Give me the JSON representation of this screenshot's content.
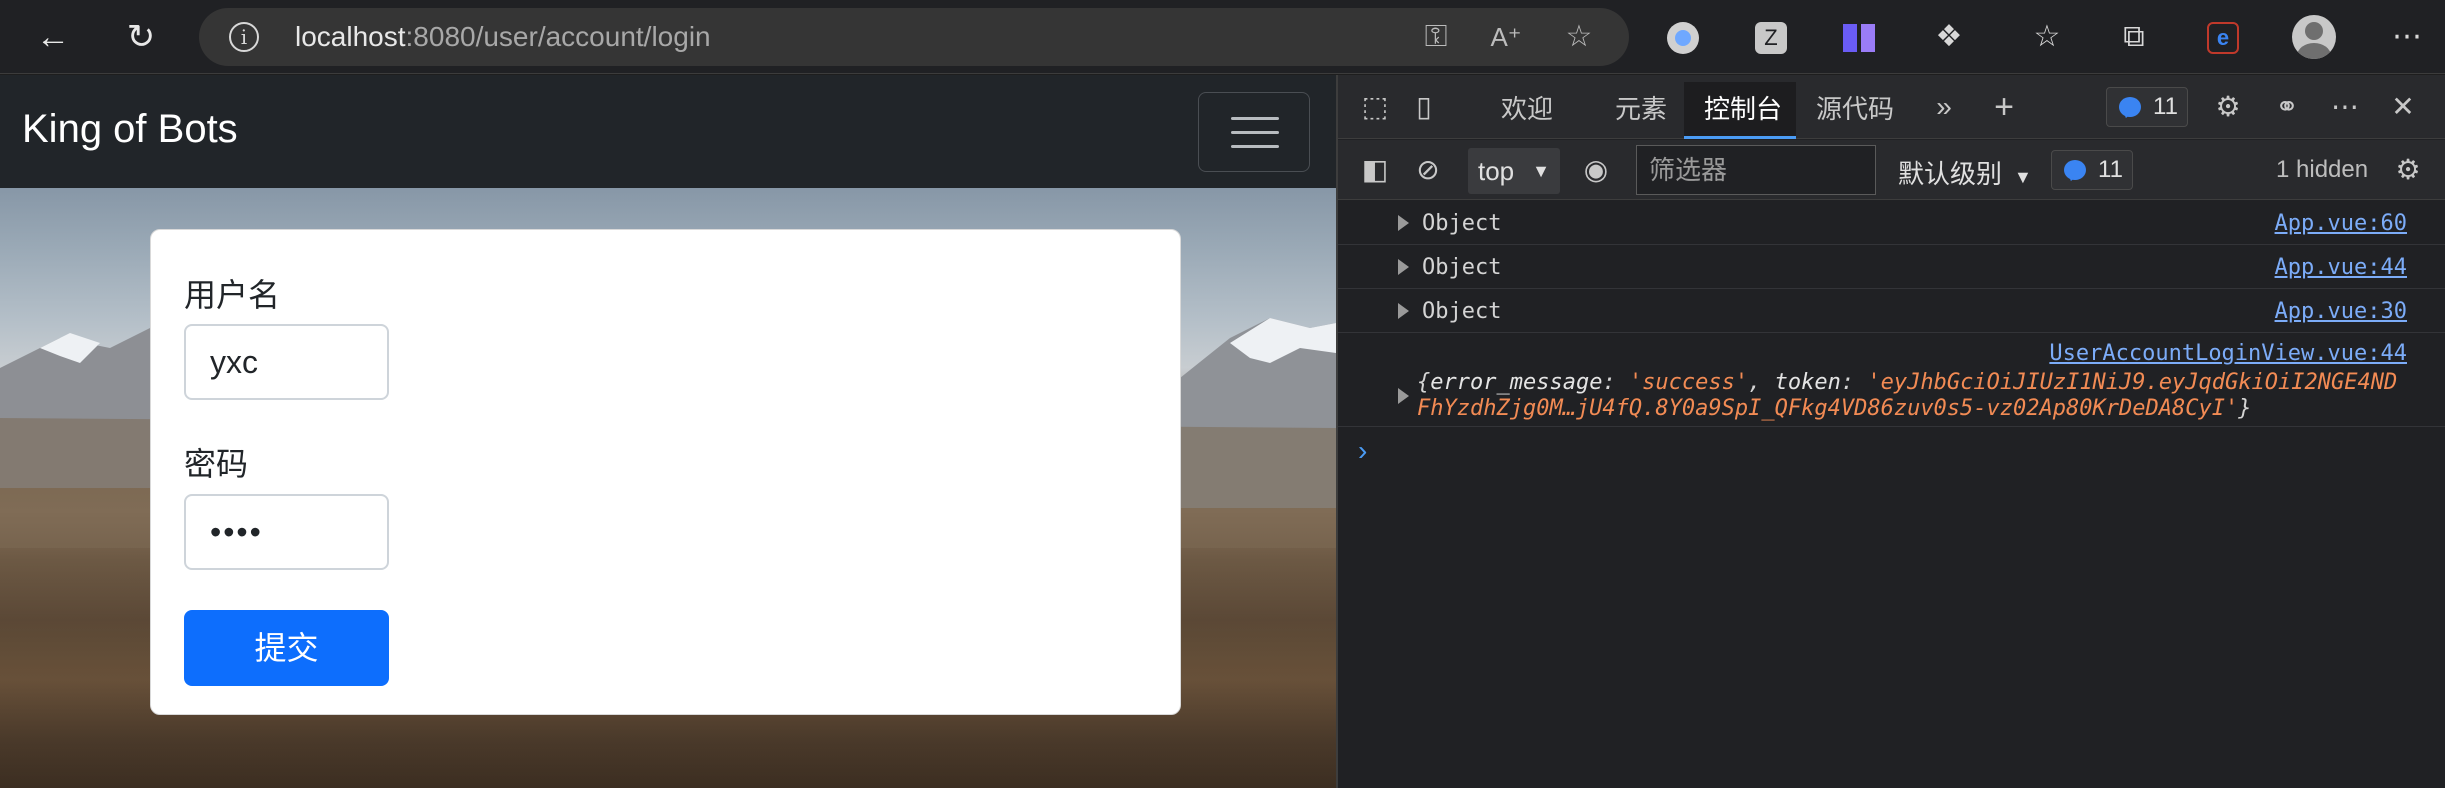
{
  "browser": {
    "url_host": "localhost",
    "url_path": ":8080/user/account/login"
  },
  "page": {
    "brand": "King of Bots",
    "form": {
      "username_label": "用户名",
      "username_value": "yxc",
      "password_label": "密码",
      "password_value": "••••",
      "submit_label": "提交"
    }
  },
  "devtools": {
    "tabs": [
      "欢迎",
      "元素",
      "控制台",
      "源代码"
    ],
    "active_tab": "控制台",
    "issues_count": "11",
    "context": "top",
    "filter_placeholder": "筛选器",
    "level": "默认级别",
    "messages_count": "11",
    "hidden": "1 hidden",
    "logs": [
      {
        "text": "Object",
        "source": "App.vue:60"
      },
      {
        "text": "Object",
        "source": "App.vue:44"
      },
      {
        "text": "Object",
        "source": "App.vue:30"
      }
    ],
    "expanded_log": {
      "source": "UserAccountLoginView.vue:44",
      "key1": "error_message",
      "val1": "'success'",
      "key2": "token",
      "val2_line1": "'eyJhbGciOiJIUzI1NiJ9.eyJqdGkiOiI2NGE4ND",
      "val2_line2": "FhYzdhZjg0M…jU4fQ.8Y0a9SpI_QFkg4VD86zuv0s5-vz02Ap80KrDeDA8CyI'"
    },
    "accent_color": "#4b9cf5"
  }
}
